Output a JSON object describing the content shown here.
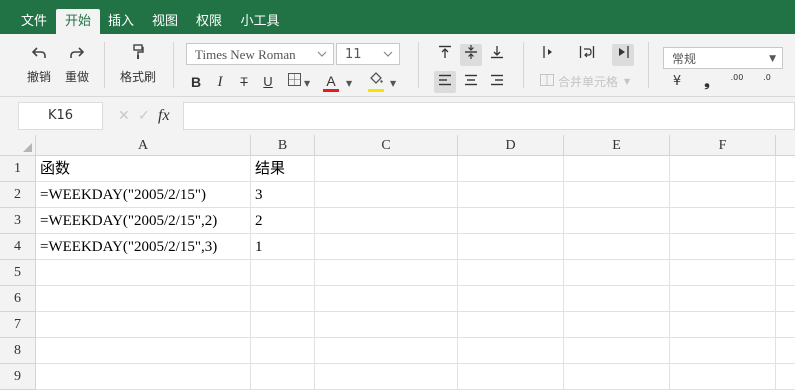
{
  "menu": {
    "items": [
      "文件",
      "开始",
      "插入",
      "视图",
      "权限",
      "小工具"
    ],
    "active": "开始"
  },
  "ribbon": {
    "undo_label": "撤销",
    "redo_label": "重做",
    "format_painter_label": "格式刷",
    "font_name": "Times New Roman",
    "font_size": "11",
    "bold": "B",
    "italic": "I",
    "strike": "T",
    "underline": "U",
    "font_color_glyph": "A",
    "font_color": "#e02020",
    "fill_color": "#f5e400",
    "merge_label": "合并单元格",
    "number_format": "常规",
    "currency_glyph": "¥",
    "comma_glyph": "❟",
    "inc_decimal": ".00",
    "dec_decimal": ".0"
  },
  "formula_bar": {
    "name_box": "K16",
    "cancel_glyph": "✕",
    "confirm_glyph": "✓",
    "fx_label": "fx",
    "content": ""
  },
  "sheet": {
    "columns": [
      "A",
      "B",
      "C",
      "D",
      "E",
      "F"
    ],
    "rows": [
      "1",
      "2",
      "3",
      "4",
      "5",
      "6",
      "7",
      "8",
      "9"
    ],
    "cells": [
      [
        "函数",
        "结果"
      ],
      [
        "=WEEKDAY(\"2005/2/15\")",
        "3"
      ],
      [
        "=WEEKDAY(\"2005/2/15\",2)",
        "2"
      ],
      [
        "=WEEKDAY(\"2005/2/15\",3)",
        "1"
      ],
      [
        "",
        ""
      ],
      [
        "",
        ""
      ],
      [
        "",
        ""
      ],
      [
        "",
        ""
      ],
      [
        "",
        ""
      ]
    ]
  },
  "colors": {
    "menubar_bg": "#217346",
    "ribbon_bg": "#f3f3f3"
  }
}
